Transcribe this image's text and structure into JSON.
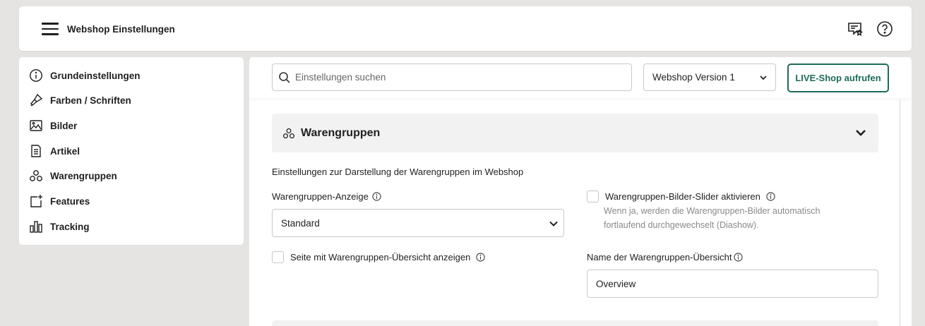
{
  "header": {
    "title": "Webshop Einstellungen",
    "icons": [
      "menu-icon",
      "feedback-star-icon",
      "help-icon"
    ]
  },
  "sidebar": {
    "items": [
      {
        "label": "Grundeinstellungen",
        "icon": "info-icon"
      },
      {
        "label": "Farben / Schriften",
        "icon": "paint-brush-icon"
      },
      {
        "label": "Bilder",
        "icon": "image-icon"
      },
      {
        "label": "Artikel",
        "icon": "document-list-icon"
      },
      {
        "label": "Warengruppen",
        "icon": "groups-icon"
      },
      {
        "label": "Features",
        "icon": "add-feature-icon"
      },
      {
        "label": "Tracking",
        "icon": "bar-chart-icon"
      }
    ]
  },
  "toolbar": {
    "search_placeholder": "Einstellungen suchen",
    "version_select": "Webshop Version 1",
    "live_button": "LIVE-Shop aufrufen"
  },
  "section": {
    "title": "Warengruppen",
    "description": "Einstellungen zur Darstellung der Warengruppen im Webshop",
    "display_label": "Warengruppen-Anzeige",
    "display_value": "Standard",
    "slider_label": "Warengruppen-Bilder-Slider aktivieren",
    "slider_hint": "Wenn ja, werden die Warengruppen-Bilder automatisch fortlaufend durchgewechselt (Diashow).",
    "overview_checkbox_label": "Seite mit Warengruppen-Übersicht anzeigen",
    "overview_name_label": "Name der Warengruppen-Übersicht",
    "overview_name_value": "Overview"
  },
  "colors": {
    "accent": "#1e6b5a",
    "background": "#e6e4e2",
    "section_header": "#f2f2f2"
  }
}
